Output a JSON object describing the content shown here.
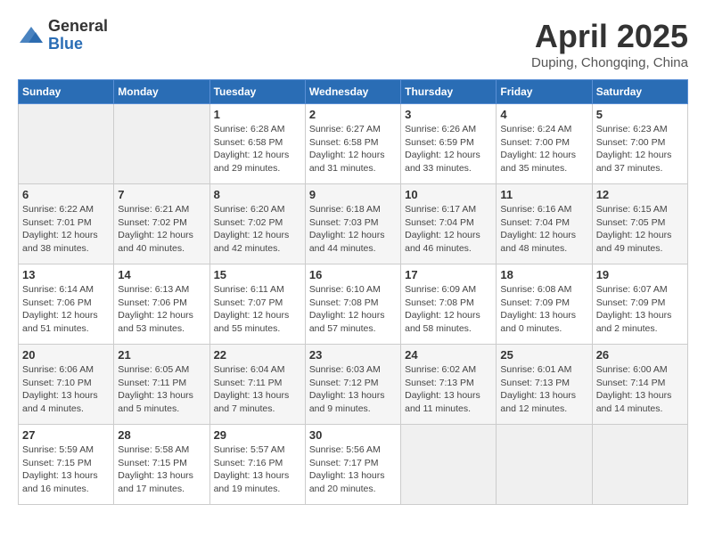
{
  "logo": {
    "general": "General",
    "blue": "Blue"
  },
  "title": "April 2025",
  "subtitle": "Duping, Chongqing, China",
  "days_of_week": [
    "Sunday",
    "Monday",
    "Tuesday",
    "Wednesday",
    "Thursday",
    "Friday",
    "Saturday"
  ],
  "weeks": [
    [
      {
        "day": "",
        "info": ""
      },
      {
        "day": "",
        "info": ""
      },
      {
        "day": "1",
        "info": "Sunrise: 6:28 AM\nSunset: 6:58 PM\nDaylight: 12 hours\nand 29 minutes."
      },
      {
        "day": "2",
        "info": "Sunrise: 6:27 AM\nSunset: 6:58 PM\nDaylight: 12 hours\nand 31 minutes."
      },
      {
        "day": "3",
        "info": "Sunrise: 6:26 AM\nSunset: 6:59 PM\nDaylight: 12 hours\nand 33 minutes."
      },
      {
        "day": "4",
        "info": "Sunrise: 6:24 AM\nSunset: 7:00 PM\nDaylight: 12 hours\nand 35 minutes."
      },
      {
        "day": "5",
        "info": "Sunrise: 6:23 AM\nSunset: 7:00 PM\nDaylight: 12 hours\nand 37 minutes."
      }
    ],
    [
      {
        "day": "6",
        "info": "Sunrise: 6:22 AM\nSunset: 7:01 PM\nDaylight: 12 hours\nand 38 minutes."
      },
      {
        "day": "7",
        "info": "Sunrise: 6:21 AM\nSunset: 7:02 PM\nDaylight: 12 hours\nand 40 minutes."
      },
      {
        "day": "8",
        "info": "Sunrise: 6:20 AM\nSunset: 7:02 PM\nDaylight: 12 hours\nand 42 minutes."
      },
      {
        "day": "9",
        "info": "Sunrise: 6:18 AM\nSunset: 7:03 PM\nDaylight: 12 hours\nand 44 minutes."
      },
      {
        "day": "10",
        "info": "Sunrise: 6:17 AM\nSunset: 7:04 PM\nDaylight: 12 hours\nand 46 minutes."
      },
      {
        "day": "11",
        "info": "Sunrise: 6:16 AM\nSunset: 7:04 PM\nDaylight: 12 hours\nand 48 minutes."
      },
      {
        "day": "12",
        "info": "Sunrise: 6:15 AM\nSunset: 7:05 PM\nDaylight: 12 hours\nand 49 minutes."
      }
    ],
    [
      {
        "day": "13",
        "info": "Sunrise: 6:14 AM\nSunset: 7:06 PM\nDaylight: 12 hours\nand 51 minutes."
      },
      {
        "day": "14",
        "info": "Sunrise: 6:13 AM\nSunset: 7:06 PM\nDaylight: 12 hours\nand 53 minutes."
      },
      {
        "day": "15",
        "info": "Sunrise: 6:11 AM\nSunset: 7:07 PM\nDaylight: 12 hours\nand 55 minutes."
      },
      {
        "day": "16",
        "info": "Sunrise: 6:10 AM\nSunset: 7:08 PM\nDaylight: 12 hours\nand 57 minutes."
      },
      {
        "day": "17",
        "info": "Sunrise: 6:09 AM\nSunset: 7:08 PM\nDaylight: 12 hours\nand 58 minutes."
      },
      {
        "day": "18",
        "info": "Sunrise: 6:08 AM\nSunset: 7:09 PM\nDaylight: 13 hours\nand 0 minutes."
      },
      {
        "day": "19",
        "info": "Sunrise: 6:07 AM\nSunset: 7:09 PM\nDaylight: 13 hours\nand 2 minutes."
      }
    ],
    [
      {
        "day": "20",
        "info": "Sunrise: 6:06 AM\nSunset: 7:10 PM\nDaylight: 13 hours\nand 4 minutes."
      },
      {
        "day": "21",
        "info": "Sunrise: 6:05 AM\nSunset: 7:11 PM\nDaylight: 13 hours\nand 5 minutes."
      },
      {
        "day": "22",
        "info": "Sunrise: 6:04 AM\nSunset: 7:11 PM\nDaylight: 13 hours\nand 7 minutes."
      },
      {
        "day": "23",
        "info": "Sunrise: 6:03 AM\nSunset: 7:12 PM\nDaylight: 13 hours\nand 9 minutes."
      },
      {
        "day": "24",
        "info": "Sunrise: 6:02 AM\nSunset: 7:13 PM\nDaylight: 13 hours\nand 11 minutes."
      },
      {
        "day": "25",
        "info": "Sunrise: 6:01 AM\nSunset: 7:13 PM\nDaylight: 13 hours\nand 12 minutes."
      },
      {
        "day": "26",
        "info": "Sunrise: 6:00 AM\nSunset: 7:14 PM\nDaylight: 13 hours\nand 14 minutes."
      }
    ],
    [
      {
        "day": "27",
        "info": "Sunrise: 5:59 AM\nSunset: 7:15 PM\nDaylight: 13 hours\nand 16 minutes."
      },
      {
        "day": "28",
        "info": "Sunrise: 5:58 AM\nSunset: 7:15 PM\nDaylight: 13 hours\nand 17 minutes."
      },
      {
        "day": "29",
        "info": "Sunrise: 5:57 AM\nSunset: 7:16 PM\nDaylight: 13 hours\nand 19 minutes."
      },
      {
        "day": "30",
        "info": "Sunrise: 5:56 AM\nSunset: 7:17 PM\nDaylight: 13 hours\nand 20 minutes."
      },
      {
        "day": "",
        "info": ""
      },
      {
        "day": "",
        "info": ""
      },
      {
        "day": "",
        "info": ""
      }
    ]
  ]
}
